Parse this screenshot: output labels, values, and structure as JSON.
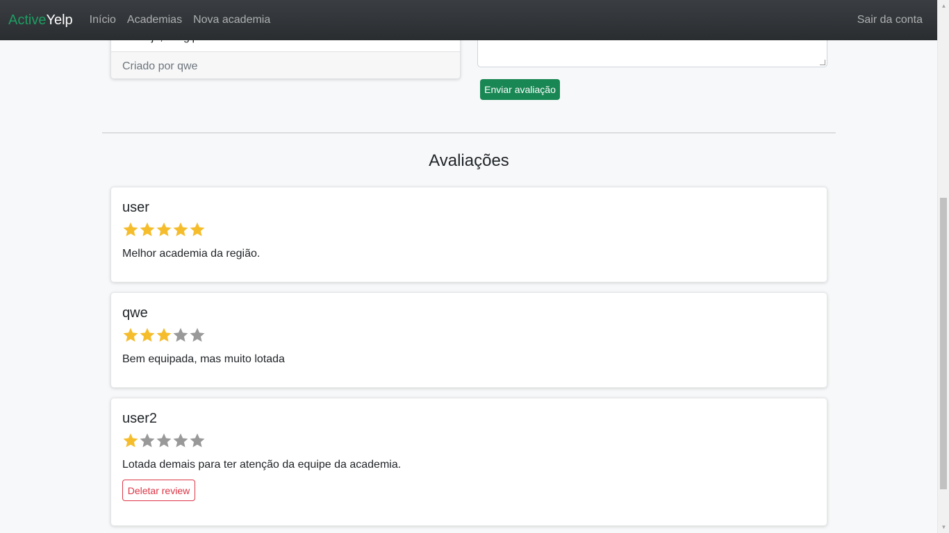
{
  "navbar": {
    "brand_part1": "Active",
    "brand_part2": "Yelp",
    "links": [
      "Início",
      "Academias",
      "Nova academia"
    ],
    "logout": "Sair da conta"
  },
  "gym_card": {
    "location": "Aracaju, Sergipe",
    "created_by": "Criado por qwe"
  },
  "review_form": {
    "submit_label": "Enviar avaliação"
  },
  "reviews_section": {
    "title": "Avaliações",
    "reviews": [
      {
        "author": "user",
        "rating": 5,
        "text": "Melhor academia da região."
      },
      {
        "author": "qwe",
        "rating": 3,
        "text": "Bem equipada, mas muito lotada"
      },
      {
        "author": "user2",
        "rating": 1,
        "text": "Lotada demais para ter atenção da equipe da academia.",
        "delete_label": "Deletar review"
      }
    ]
  },
  "colors": {
    "star_filled": "#f5bd2c",
    "star_empty": "#999999",
    "success": "#198754",
    "danger": "#dc3545"
  }
}
